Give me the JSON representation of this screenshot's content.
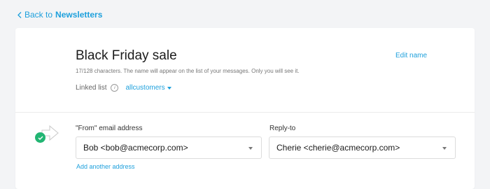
{
  "nav": {
    "back_prefix": "Back to",
    "back_target": "Newsletters"
  },
  "campaign": {
    "name": "Black Friday sale",
    "edit_label": "Edit name",
    "hint": "17/128 characters. The name will appear on the list of your messages. Only you will see it.",
    "linked_list_label": "Linked list",
    "linked_list_value": "allcustomers"
  },
  "sender": {
    "from_label": "\"From\" email address",
    "from_value": "Bob <bob@acmecorp.com>",
    "reply_label": "Reply-to",
    "reply_value": "Cherie <cherie@acmecorp.com>",
    "add_address_label": "Add another address"
  },
  "colors": {
    "accent": "#1ea0dc",
    "success": "#22b573",
    "background": "#f3f4f6"
  }
}
